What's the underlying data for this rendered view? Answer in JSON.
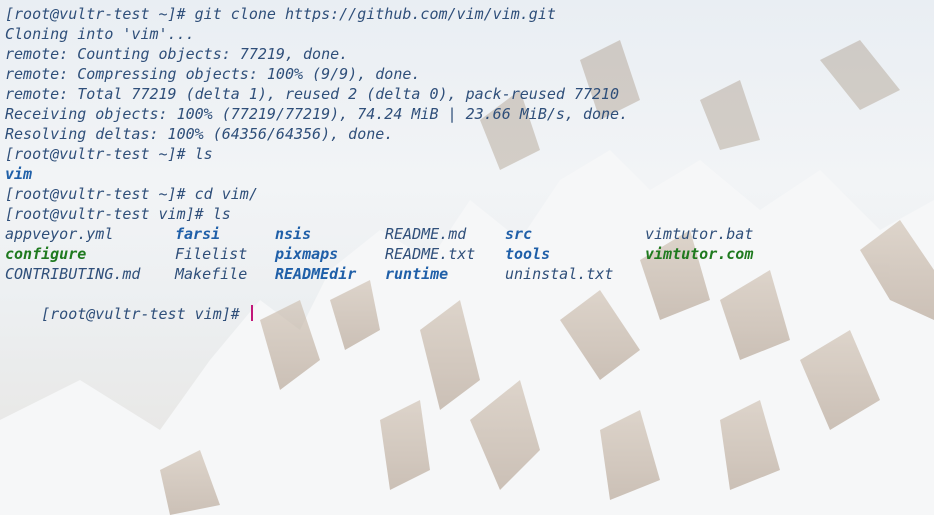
{
  "terminal": {
    "lines": [
      "[root@vultr-test ~]# git clone https://github.com/vim/vim.git",
      "Cloning into 'vim'...",
      "remote: Counting objects: 77219, done.",
      "remote: Compressing objects: 100% (9/9), done.",
      "remote: Total 77219 (delta 1), reused 2 (delta 0), pack-reused 77210",
      "Receiving objects: 100% (77219/77219), 74.24 MiB | 23.66 MiB/s, done.",
      "Resolving deltas: 100% (64356/64356), done.",
      "[root@vultr-test ~]# ls",
      "vim",
      "[root@vultr-test ~]# cd vim/",
      "[root@vultr-test vim]# ls"
    ],
    "listing": [
      [
        "appveyor.yml",
        "farsi",
        "nsis",
        "README.md",
        "src",
        "vimtutor.bat"
      ],
      [
        "configure",
        "Filelist",
        "pixmaps",
        "README.txt",
        "tools",
        "vimtutor.com"
      ],
      [
        "CONTRIBUTING.md",
        "Makefile",
        "READMEdir",
        "runtime",
        "uninstal.txt",
        ""
      ]
    ],
    "prompt": "[root@vultr-test vim]# "
  },
  "colors": {
    "text": "#2f4f7a",
    "directory": "#1f5fa8",
    "executable": "#1f7a1f",
    "cursor": "#c2187a"
  }
}
